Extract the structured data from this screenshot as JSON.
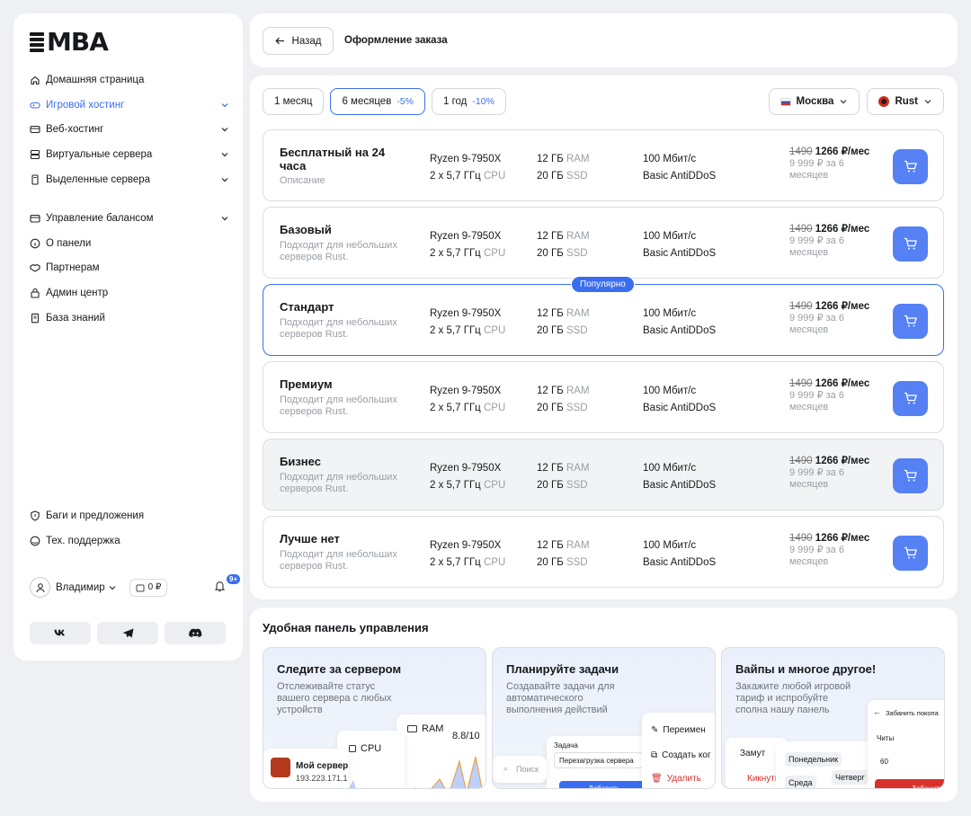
{
  "logo": {
    "text": "MBA"
  },
  "sidebar": {
    "items": [
      {
        "label": "Домашняя страница",
        "icon": "home-icon",
        "active": false,
        "expandable": false
      },
      {
        "label": "Игровой хостинг",
        "icon": "gamepad-icon",
        "active": true,
        "expandable": true
      },
      {
        "label": "Веб-хостинг",
        "icon": "web-icon",
        "active": false,
        "expandable": true
      },
      {
        "label": "Виртуальные сервера",
        "icon": "server-icon",
        "active": false,
        "expandable": true
      },
      {
        "label": "Выделенные сервера",
        "icon": "dedicated-icon",
        "active": false,
        "expandable": true
      }
    ],
    "items2": [
      {
        "label": "Управление балансом",
        "icon": "wallet-icon",
        "expandable": true
      },
      {
        "label": "О панели",
        "icon": "info-icon",
        "expandable": false
      },
      {
        "label": "Партнерам",
        "icon": "handshake-icon",
        "expandable": false
      },
      {
        "label": "Админ центр",
        "icon": "lock-icon",
        "expandable": false
      },
      {
        "label": "База знаний",
        "icon": "book-icon",
        "expandable": false
      }
    ],
    "bottom": [
      {
        "label": "Баги и предложения",
        "icon": "shield-icon"
      },
      {
        "label": "Тех. поддержка",
        "icon": "support-icon"
      }
    ],
    "user": {
      "name": "Владимир",
      "balance": "0 ₽",
      "notifications": "9+"
    },
    "socials": [
      "vk-icon",
      "telegram-icon",
      "discord-icon"
    ]
  },
  "header": {
    "back_label": "Назад",
    "title": "Оформление заказа"
  },
  "periods": [
    {
      "label": "1 месяц",
      "discount": "",
      "selected": false
    },
    {
      "label": "6 месяцев",
      "discount": "-5%",
      "selected": true
    },
    {
      "label": "1 год",
      "discount": "-10%",
      "selected": false
    }
  ],
  "location": {
    "label": "Москва"
  },
  "game": {
    "label": "Rust"
  },
  "plans": [
    {
      "name": "Бесплатный на 24 часа",
      "desc": "Описание",
      "cpu": "Ryzen 9-7950X",
      "freq": "2 x 5,7 ГГц",
      "freq_unit": "CPU",
      "ram": "12 ГБ",
      "ram_unit": "RAM",
      "ssd": "20 ГБ",
      "ssd_unit": "SSD",
      "net": "100 Мбит/с",
      "ddos": "Basic AntiDDoS",
      "old_price": "1490",
      "price": "1266 ₽/мес",
      "total": "9 999 ₽ за 6 месяцев"
    },
    {
      "name": "Базовый",
      "desc": "Подходит для небольших серверов Rust.",
      "cpu": "Ryzen 9-7950X",
      "freq": "2 x 5,7 ГГц",
      "freq_unit": "CPU",
      "ram": "12 ГБ",
      "ram_unit": "RAM",
      "ssd": "20 ГБ",
      "ssd_unit": "SSD",
      "net": "100 Мбит/с",
      "ddos": "Basic AntiDDoS",
      "old_price": "1490",
      "price": "1266 ₽/мес",
      "total": "9 999 ₽ за 6 месяцев"
    },
    {
      "name": "Стандарт",
      "desc": "Подходит для небольших серверов Rust.",
      "cpu": "Ryzen 9-7950X",
      "freq": "2 x 5,7 ГГц",
      "freq_unit": "CPU",
      "ram": "12 ГБ",
      "ram_unit": "RAM",
      "ssd": "20 ГБ",
      "ssd_unit": "SSD",
      "net": "100 Мбит/с",
      "ddos": "Basic AntiDDoS",
      "old_price": "1490",
      "price": "1266 ₽/мес",
      "total": "9 999 ₽ за 6 месяцев",
      "badge": "Популярно"
    },
    {
      "name": "Премиум",
      "desc": "Подходит для небольших серверов Rust.",
      "cpu": "Ryzen 9-7950X",
      "freq": "2 x 5,7 ГГц",
      "freq_unit": "CPU",
      "ram": "12 ГБ",
      "ram_unit": "RAM",
      "ssd": "20 ГБ",
      "ssd_unit": "SSD",
      "net": "100 Мбит/с",
      "ddos": "Basic AntiDDoS",
      "old_price": "1490",
      "price": "1266 ₽/мес",
      "total": "9 999 ₽ за 6 месяцев"
    },
    {
      "name": "Бизнес",
      "desc": "Подходит для небольших серверов Rust.",
      "cpu": "Ryzen 9-7950X",
      "freq": "2 x 5,7 ГГц",
      "freq_unit": "CPU",
      "ram": "12 ГБ",
      "ram_unit": "RAM",
      "ssd": "20 ГБ",
      "ssd_unit": "SSD",
      "net": "100 Мбит/с",
      "ddos": "Basic AntiDDoS",
      "old_price": "1490",
      "price": "1266 ₽/мес",
      "total": "9 999 ₽ за 6 месяцев"
    },
    {
      "name": "Лучше нет",
      "desc": "Подходит для небольших серверов Rust.",
      "cpu": "Ryzen 9-7950X",
      "freq": "2 x 5,7 ГГц",
      "freq_unit": "CPU",
      "ram": "12 ГБ",
      "ram_unit": "RAM",
      "ssd": "20 ГБ",
      "ssd_unit": "SSD",
      "net": "100 Мбит/с",
      "ddos": "Basic AntiDDoS",
      "old_price": "1490",
      "price": "1266 ₽/мес",
      "total": "9 999 ₽ за 6 месяцев"
    }
  ],
  "panel": {
    "title": "Удобная панель управления",
    "features": [
      {
        "title": "Следите за сервером",
        "desc": "Отслеживайте статус вашего сервера с любых устройств",
        "server_name": "Мой сервер",
        "server_ip": "193.223.171.1",
        "cpu_label": "CPU",
        "ram_label": "RAM",
        "ram_value": "8.8/10"
      },
      {
        "title": "Планируйте задачи",
        "desc": "Создавайте задачи для автоматического выполнения действий",
        "task_label": "Задача",
        "task_value": "Перезагрузка сервера",
        "search": "Поиск",
        "menu": [
          "Переимен",
          "Создать ког",
          "Удалить"
        ],
        "add_btn": "Добавить"
      },
      {
        "title": "Вайпы и многое другое!",
        "desc": "Закажите любой игровой тариф и испробуйте сполна нашу панель",
        "tags": [
          "Замут",
          "Понедельник",
          "Среда",
          "Четверг",
          "Кикнуть"
        ],
        "ban": "Забанить покопа",
        "cheats": "Читы",
        "num": "60",
        "ban_btn": "Забанить"
      }
    ]
  },
  "colors": {
    "accent": "#3b6df0",
    "cart": "#5581f4",
    "bg": "#eef0f3"
  }
}
